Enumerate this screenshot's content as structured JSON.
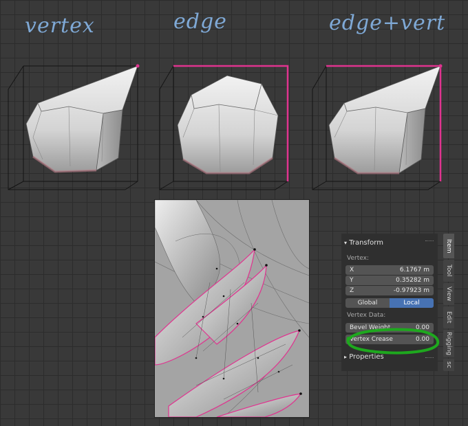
{
  "labels": {
    "vertex": "vertex",
    "edge": "edge",
    "edge_vert": "edge+vert"
  },
  "transform": {
    "header": "Transform",
    "vertex_label": "Vertex:",
    "x_label": "X",
    "x_value": "6.1767 m",
    "y_label": "Y",
    "y_value": "0.35282 m",
    "z_label": "Z",
    "z_value": "-0.97923 m",
    "global_label": "Global",
    "local_label": "Local",
    "vertex_data_label": "Vertex Data:",
    "bevel_weight_label": "Bevel Weight",
    "bevel_weight_value": "0.00",
    "vertex_crease_label": "Vertex Crease",
    "vertex_crease_value": "0.00",
    "properties_label": "Properties"
  },
  "tabs": [
    "Item",
    "Tool",
    "View",
    "Edit",
    "Rigging",
    "sc"
  ],
  "colors": {
    "selection": "#e0338f",
    "highlight_ellipse": "#1ea81e",
    "active_toggle": "#4772b3",
    "hand_label": "#7fa9d6"
  }
}
